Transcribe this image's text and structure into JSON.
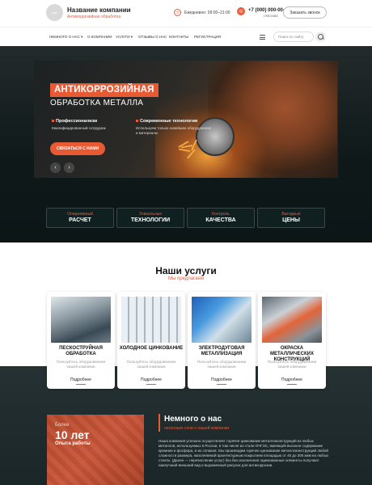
{
  "header": {
    "logo_text": "logo",
    "company_name": "Название компании",
    "company_tagline": "Антикоррозийная обработка",
    "hours": "Ежедневно: 09:00–21:00",
    "phone": "+7 (000) 000-00-00",
    "city": "г.Москва",
    "callback_label": "Заказать звонок"
  },
  "nav": {
    "items": [
      {
        "label": "НЕМНОГО О НАС"
      },
      {
        "label": "О КОМПАНИИ"
      },
      {
        "label": "УСЛУГИ"
      },
      {
        "label": "ОТЗЫВЫ О НАС"
      },
      {
        "label": "КОНТАКТЫ"
      },
      {
        "label": "РЕГИСТРАЦИЯ"
      }
    ],
    "search_placeholder": "Поиск по сайту"
  },
  "hero": {
    "title": "АНТИКОРРОЗИЙНАЯ",
    "subtitle": "ОБРАБОТКА МЕТАЛЛА",
    "features": [
      {
        "title": "Профессионализм",
        "desc": "Квалифицированный сотрудник"
      },
      {
        "title": "Современные технологии",
        "desc": "Используем только новейшее оборудование и материалы"
      }
    ],
    "cta_label": "СВЯЗАТЬСЯ С НАМИ",
    "prev_icon": "‹",
    "next_icon": "›"
  },
  "advantages": [
    {
      "top": "Оперативный",
      "bottom": "РАСЧЕТ"
    },
    {
      "top": "Уникальные",
      "bottom": "ТЕХНОЛОГИИ"
    },
    {
      "top": "Контроль",
      "bottom": "КАЧЕСТВА"
    },
    {
      "top": "Выгодные",
      "bottom": "ЦЕНЫ"
    }
  ],
  "services": {
    "title": "Наши услуги",
    "subtitle": "Мы предлагаем",
    "items": [
      {
        "name": "ПЕСКОСТРУЙНАЯ ОБРАБОТКА",
        "desc": "Пользуйтесь оборудованием нашей компании",
        "more": "Подробнее"
      },
      {
        "name": "ХОЛОДНОЕ ЦИНКОВАНИЕ",
        "desc": "Пользуйтесь оборудованием нашей компании",
        "more": "Подробнее"
      },
      {
        "name": "ЭЛЕКТРОДУГОВАЯ МЕТАЛЛИЗАЦИЯ",
        "desc": "Пользуйтесь оборудованием нашей компании",
        "more": "Подробнее"
      },
      {
        "name": "ОКРАСКА МЕТАЛЛИЧЕСКИХ КОНСТРУКЦИЙ",
        "desc": "Пользуйтесь оборудованием нашей компании",
        "more": "Подробнее"
      }
    ]
  },
  "about": {
    "more": "Более",
    "years": "10 лет",
    "experience": "Опыта работы",
    "title": "Немного о нас",
    "subtitle": "несколько слов о нашей компании",
    "text": "Наша компания успешно осуществляет горячее цинкование металлоконструкций из любых металлов, используемых в России, в том числе из стали ОЧГЭС, имеющей высокое содержание кремния и фосфора, и их сплавов. Мы производим горячее цинкование металлоконструкций любой сложности размера, наполняемой архитектурным покрытием площадью от 40 до 300 мкм на любых сталях. (Далее — перечисление услуг) без без исключения оцинкованные элементы получают наилучший внешний вид и выраженный рисунок для антикоррозии."
  },
  "colors": {
    "accent": "#e85a34",
    "dark": "#0e1819"
  }
}
